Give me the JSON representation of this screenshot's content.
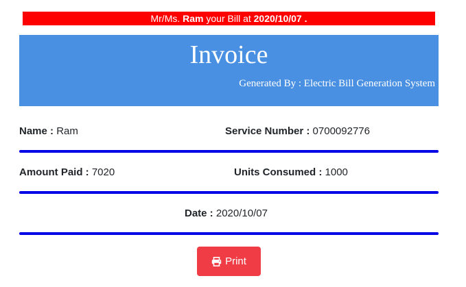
{
  "notice": {
    "prefix": "Mr/Ms. ",
    "name": "Ram",
    "middle": " your Bill at ",
    "date": "2020/10/07",
    "suffix": " ."
  },
  "header": {
    "title": "Invoice",
    "subtitle": "Generated By : Electric Bill Generation System"
  },
  "details": {
    "name_label": "Name :",
    "name_value": " Ram",
    "service_label": "Service Number :",
    "service_value": " 0700092776",
    "amount_label": "Amount Paid :",
    "amount_value": " 7020",
    "units_label": "Units Consumed :",
    "units_value": " 1000",
    "date_label": "Date :",
    "date_value": " 2020/10/07"
  },
  "actions": {
    "print_label": "Print",
    "print_icon": "printer-icon"
  },
  "colors": {
    "notice_bg": "#ff0000",
    "header_bg": "#4a90e2",
    "divider": "#0000e6",
    "print_bg": "#f03c44"
  }
}
